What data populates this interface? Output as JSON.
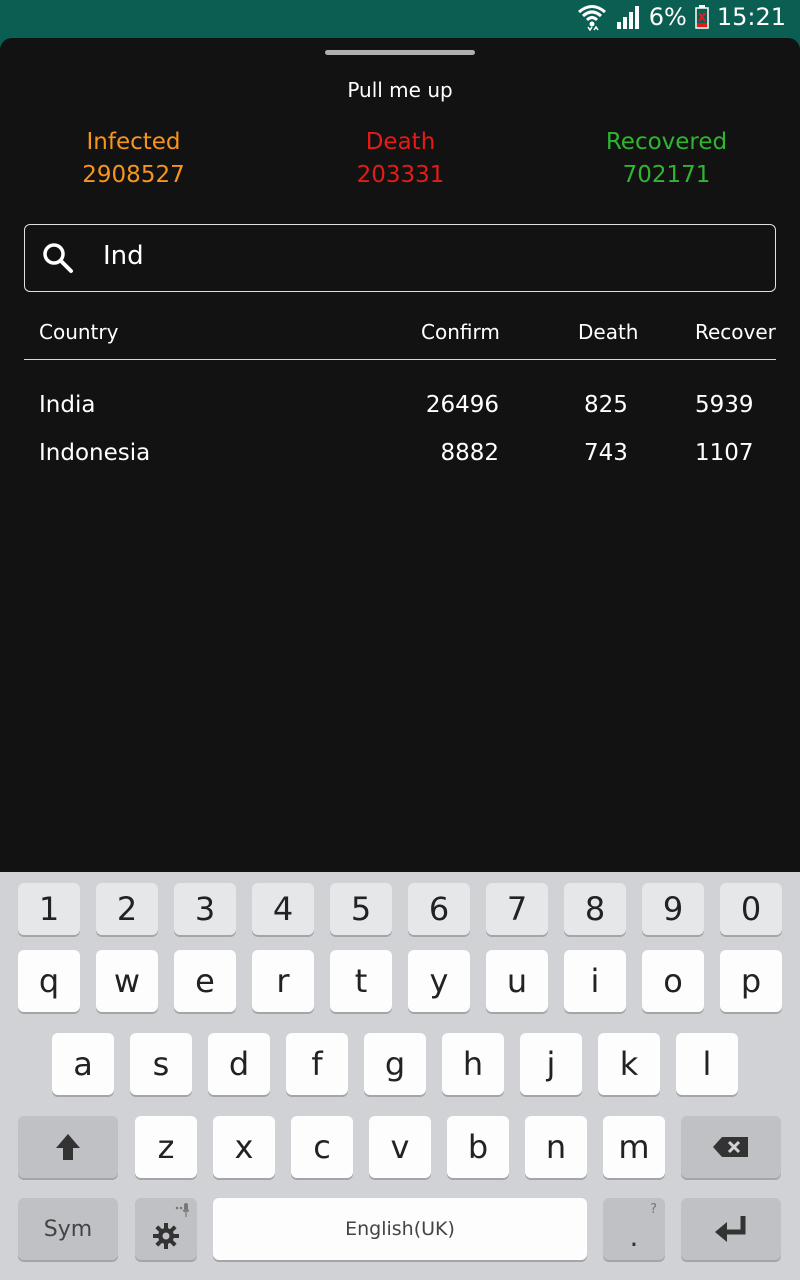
{
  "status": {
    "battery": "6%",
    "time": "15:21"
  },
  "sheet": {
    "pull_label": "Pull me up"
  },
  "summary": {
    "infected": {
      "label": "Infected",
      "value": "2908527"
    },
    "death": {
      "label": "Death",
      "value": "203331"
    },
    "recovered": {
      "label": "Recovered",
      "value": "702171"
    }
  },
  "search": {
    "value": "Ind"
  },
  "table": {
    "headers": [
      "Country",
      "Confirm",
      "Death",
      "Recover"
    ],
    "rows": [
      {
        "country": "India",
        "confirm": "26496",
        "death": "825",
        "recover": "5939"
      },
      {
        "country": "Indonesia",
        "confirm": "8882",
        "death": "743",
        "recover": "1107"
      }
    ]
  },
  "keyboard": {
    "numbers": [
      "1",
      "2",
      "3",
      "4",
      "5",
      "6",
      "7",
      "8",
      "9",
      "0"
    ],
    "row1": [
      "q",
      "w",
      "e",
      "r",
      "t",
      "y",
      "u",
      "i",
      "o",
      "p"
    ],
    "row2": [
      "a",
      "s",
      "d",
      "f",
      "g",
      "h",
      "j",
      "k",
      "l"
    ],
    "row3": [
      "z",
      "x",
      "c",
      "v",
      "b",
      "n",
      "m"
    ],
    "sym": "Sym",
    "space": "English(UK)",
    "period": ".",
    "period_hint": "?"
  },
  "colors": {
    "infected": "#f7941d",
    "death": "#e41b17",
    "recovered": "#2fb52f",
    "statusbar": "#0b5e52"
  }
}
